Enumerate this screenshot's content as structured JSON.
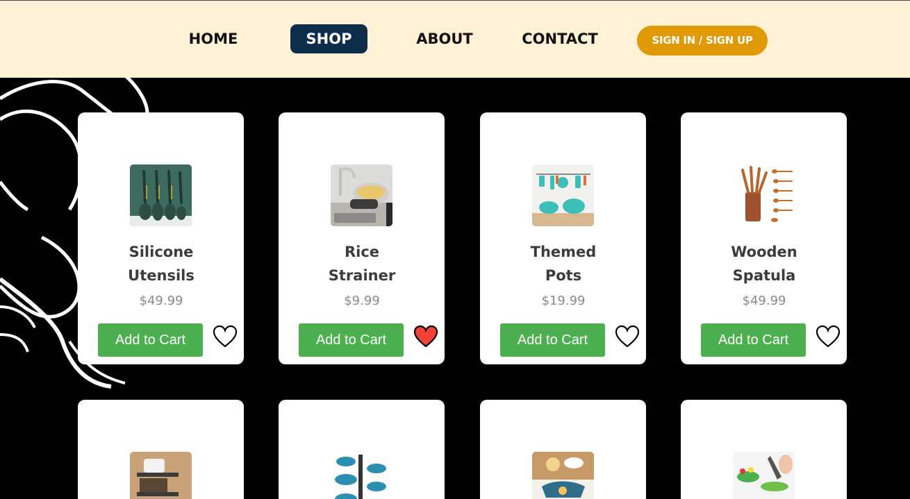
{
  "nav": {
    "home": "HOME",
    "shop": "SHOP",
    "about": "ABOUT",
    "contact": "CONTACT",
    "signin": "SIGN IN / SIGN UP"
  },
  "colors": {
    "nav_bg": "#fff1d6",
    "active_tab": "#0d2d4a",
    "signin_button": "#e09a06",
    "add_to_cart": "#4caf50",
    "heart_filled": "#f44336",
    "page_bg": "#000000"
  },
  "products": [
    {
      "name_line1": "Silicone",
      "name_line2": "Utensils",
      "price": "$49.99",
      "button": "Add to Cart",
      "favorited": false,
      "icon": "heart-outline-icon"
    },
    {
      "name_line1": "Rice",
      "name_line2": "Strainer",
      "price": "$9.99",
      "button": "Add to Cart",
      "favorited": true,
      "icon": "heart-filled-icon"
    },
    {
      "name_line1": "Themed",
      "name_line2": "Pots",
      "price": "$19.99",
      "button": "Add to Cart",
      "favorited": false,
      "icon": "heart-outline-icon"
    },
    {
      "name_line1": "Wooden",
      "name_line2": "Spatula",
      "price": "$49.99",
      "button": "Add to Cart",
      "favorited": false,
      "icon": "heart-outline-icon"
    }
  ]
}
